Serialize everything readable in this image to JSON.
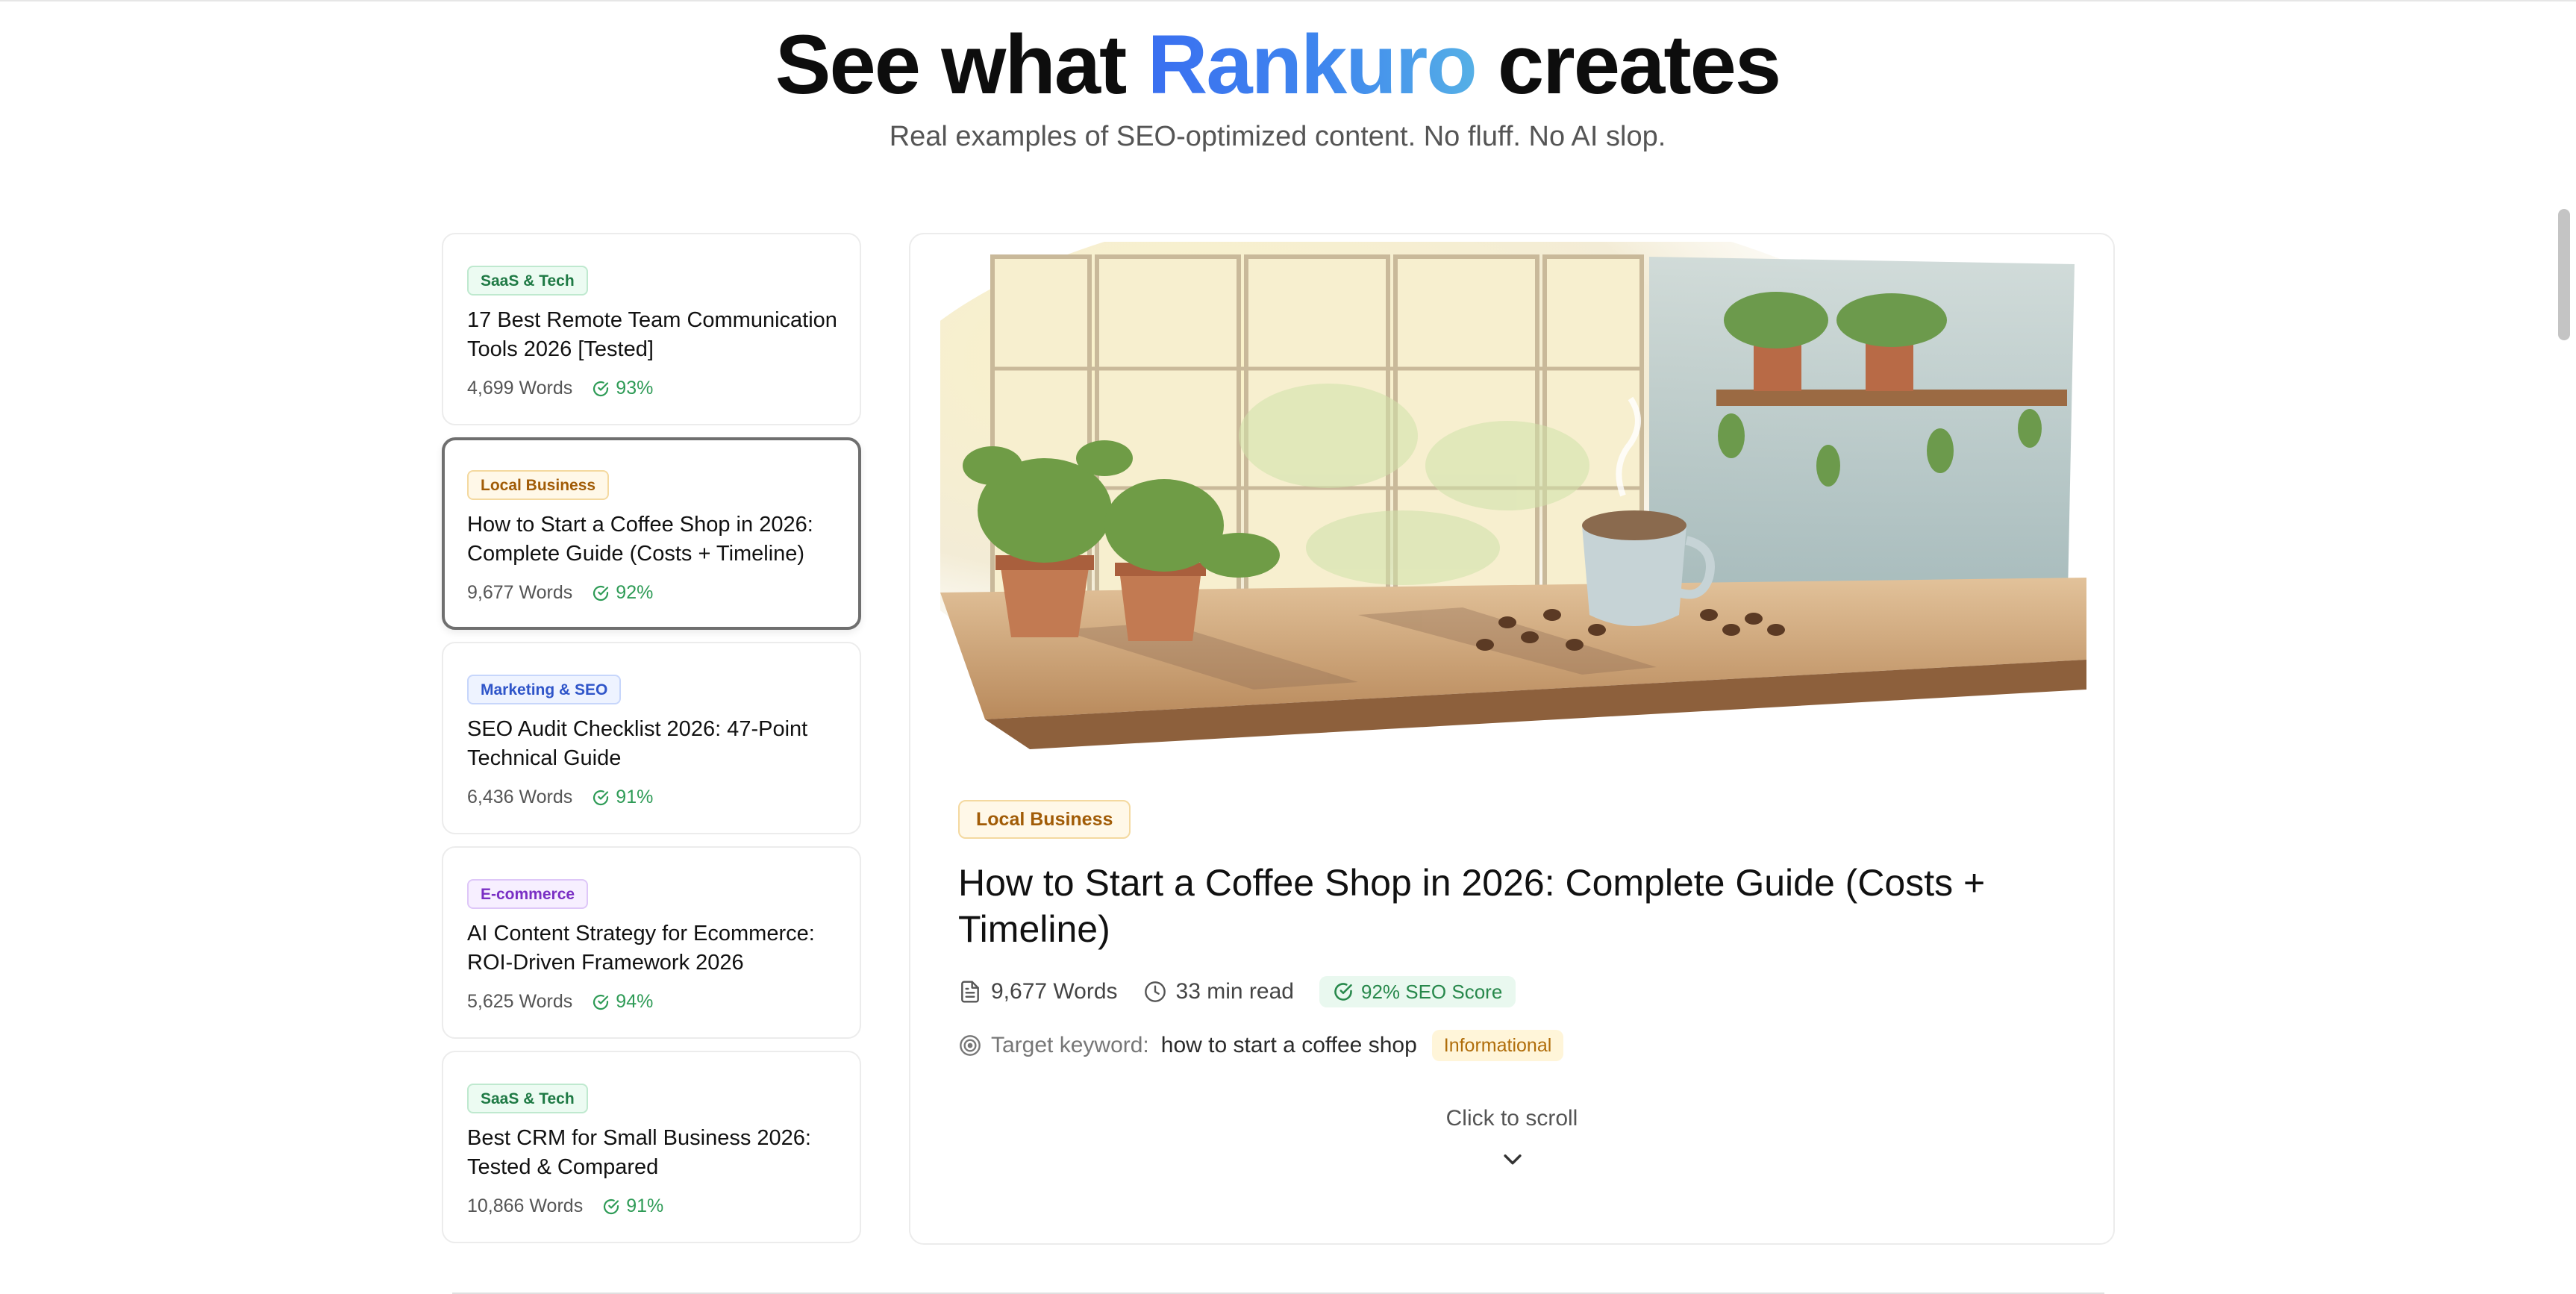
{
  "hero": {
    "title_pre": "See what",
    "brand": "Rankuro",
    "title_post": "creates",
    "subtitle": "Real examples of SEO-optimized content. No fluff. No AI slop."
  },
  "articles": [
    {
      "category": "SaaS & Tech",
      "title": "17 Best Remote Team Communication Tools 2026 [Tested]",
      "words": "4,699 Words",
      "score": "93%"
    },
    {
      "category": "Local Business",
      "title": "How to Start a Coffee Shop in 2026: Complete Guide (Costs + Timeline)",
      "words": "9,677 Words",
      "score": "92%",
      "selected": true
    },
    {
      "category": "Marketing & SEO",
      "title": "SEO Audit Checklist 2026: 47-Point Technical Guide",
      "words": "6,436 Words",
      "score": "91%"
    },
    {
      "category": "E-commerce",
      "title": "AI Content Strategy for Ecommerce: ROI-Driven Framework 2026",
      "words": "5,625 Words",
      "score": "94%"
    },
    {
      "category": "SaaS & Tech",
      "title": "Best CRM for Small Business 2026: Tested & Compared",
      "words": "10,866 Words",
      "score": "91%"
    }
  ],
  "preview": {
    "category": "Local Business",
    "title": "How to Start a Coffee Shop in 2026: Complete Guide (Costs + Timeline)",
    "words": "9,677 Words",
    "read_time": "33 min read",
    "seo_score": "92% SEO Score",
    "keyword_label": "Target keyword:",
    "keyword": "how to start a coffee shop",
    "intent": "Informational",
    "scroll_hint": "Click to scroll"
  },
  "icons": {
    "words": "document-icon",
    "read_time": "clock-icon",
    "score": "check-circle-icon",
    "keyword": "target-icon",
    "scroll": "chevron-down-icon"
  },
  "colors": {
    "brand_start": "#3a6ff0",
    "brand_end": "#56b0e6",
    "score_green": "#2e9b56",
    "tag_saas": "#1f7a45",
    "tag_local": "#a15c07",
    "tag_marketing": "#2f55c9",
    "tag_ecommerce": "#7a2fc4"
  }
}
